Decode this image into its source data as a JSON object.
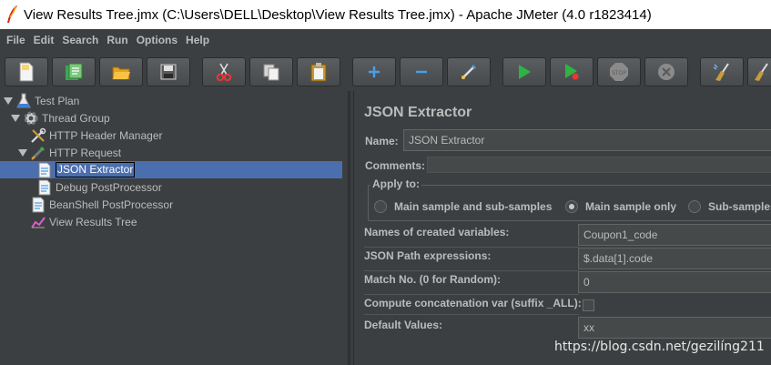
{
  "window": {
    "title": "View Results Tree.jmx (C:\\Users\\DELL\\Desktop\\View Results Tree.jmx) - Apache JMeter (4.0 r1823414)"
  },
  "menubar": [
    "File",
    "Edit",
    "Search",
    "Run",
    "Options",
    "Help"
  ],
  "toolbar": {
    "icons": [
      "new-icon",
      "templates-icon",
      "open-icon",
      "save-icon",
      "cut-icon",
      "copy-icon",
      "paste-icon",
      "expand-icon",
      "collapse-icon",
      "toggle-icon",
      "start-icon",
      "start-no-pauses-icon",
      "stop-icon",
      "shutdown-icon",
      "clear-icon",
      "clear-all-icon"
    ]
  },
  "tree": {
    "nodes": [
      {
        "label": "Test Plan",
        "icon": "test-plan-icon"
      },
      {
        "label": "Thread Group",
        "icon": "thread-group-icon"
      },
      {
        "label": "HTTP Header Manager",
        "icon": "header-manager-icon"
      },
      {
        "label": "HTTP Request",
        "icon": "http-request-icon"
      },
      {
        "label": "JSON Extractor",
        "icon": "extractor-icon"
      },
      {
        "label": "Debug PostProcessor",
        "icon": "postprocessor-icon"
      },
      {
        "label": "BeanShell PostProcessor",
        "icon": "postprocessor-icon"
      },
      {
        "label": "View Results Tree",
        "icon": "results-tree-icon"
      }
    ],
    "selected": "JSON Extractor"
  },
  "panel": {
    "title": "JSON Extractor",
    "name_label": "Name:",
    "name_value": "JSON Extractor",
    "comments_label": "Comments:",
    "comments_value": "",
    "apply_to": {
      "legend": "Apply to:",
      "options": [
        "Main sample and sub-samples",
        "Main sample only",
        "Sub-samples"
      ],
      "selected": "Main sample only"
    },
    "fields": [
      {
        "label": "Names of created variables:",
        "value": "Coupon1_code"
      },
      {
        "label": "JSON Path expressions:",
        "value": "$.data[1].code"
      },
      {
        "label": "Match No. (0 for Random):",
        "value": "0"
      }
    ],
    "concat_label": "Compute concatenation var (suffix _ALL):",
    "concat_checked": false,
    "default_label": "Default Values:",
    "default_value": "xx"
  },
  "watermark": "https://blog.csdn.net/gezilíng211"
}
